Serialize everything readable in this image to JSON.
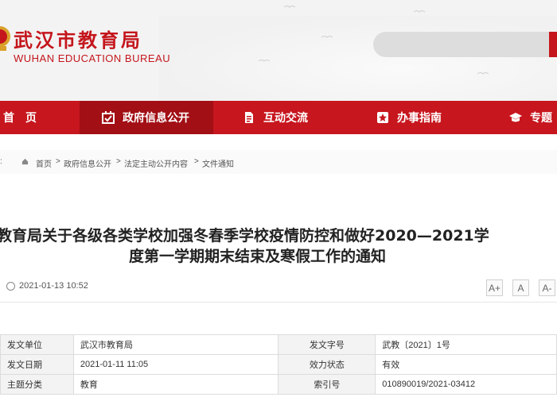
{
  "site": {
    "title": "武汉市教育局",
    "subtitle": "WUHAN EDUCATION BUREAU"
  },
  "nav": {
    "items": [
      {
        "label": "首　页",
        "icon": "home-icon",
        "active": false
      },
      {
        "label": "政府信息公开",
        "icon": "calendar-check-icon",
        "active": true
      },
      {
        "label": "互动交流",
        "icon": "document-icon",
        "active": false
      },
      {
        "label": "办事指南",
        "icon": "star-icon",
        "active": false
      },
      {
        "label": "专题",
        "icon": "graduation-cap-icon",
        "active": false
      }
    ]
  },
  "breadcrumb": {
    "items": [
      "首页",
      "政府信息公开",
      "法定主动公开内容",
      "文件通知"
    ],
    "separator": ">"
  },
  "article": {
    "title_line1": "教育局关于各级各类学校加强冬春季学校疫情防控和做好2020—2021学",
    "title_line2": "度第一学期期末结束及寒假工作的通知",
    "date": "2021-01-13 10:52",
    "font_buttons": [
      "A+",
      "A",
      "A-"
    ]
  },
  "info_table": {
    "rows": [
      {
        "label1": "发文单位",
        "value1": "武汉市教育局",
        "label2": "发文字号",
        "value2": "武教〔2021〕1号"
      },
      {
        "label1": "发文日期",
        "value1": "2021-01-11 11:05",
        "label2": "效力状态",
        "value2": "有效"
      },
      {
        "label1": "主题分类",
        "value1": "教育",
        "label2": "索引号",
        "value2": "010890019/2021-03412"
      }
    ]
  },
  "colors": {
    "brand_red": "#c7161e",
    "nav_active": "#a20f15",
    "title_red": "#c4161c"
  }
}
